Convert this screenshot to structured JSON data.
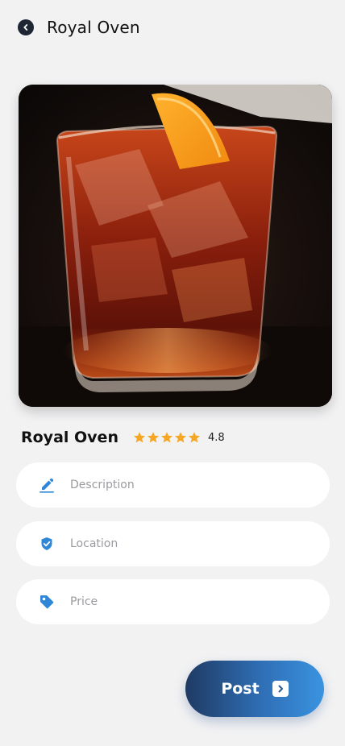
{
  "header": {
    "back_icon": "chevron-left-circle-icon",
    "title": "Royal Oven"
  },
  "photo": {
    "subject": "cocktail-glass-photo"
  },
  "item": {
    "name": "Royal Oven",
    "rating_stars": 5,
    "rating_value": "4.8",
    "star_color": "#f5a623"
  },
  "form": {
    "description": {
      "placeholder": "Description",
      "icon": "pencil-icon"
    },
    "location": {
      "placeholder": "Location",
      "icon": "location-check-icon"
    },
    "price": {
      "placeholder": "Price",
      "icon": "price-tag-icon"
    }
  },
  "actions": {
    "post_label": "Post",
    "post_icon": "chevron-right-square-icon"
  },
  "colors": {
    "accent": "#3a93e0",
    "accent_dark": "#1f3a63",
    "background": "#f2f2f3"
  }
}
